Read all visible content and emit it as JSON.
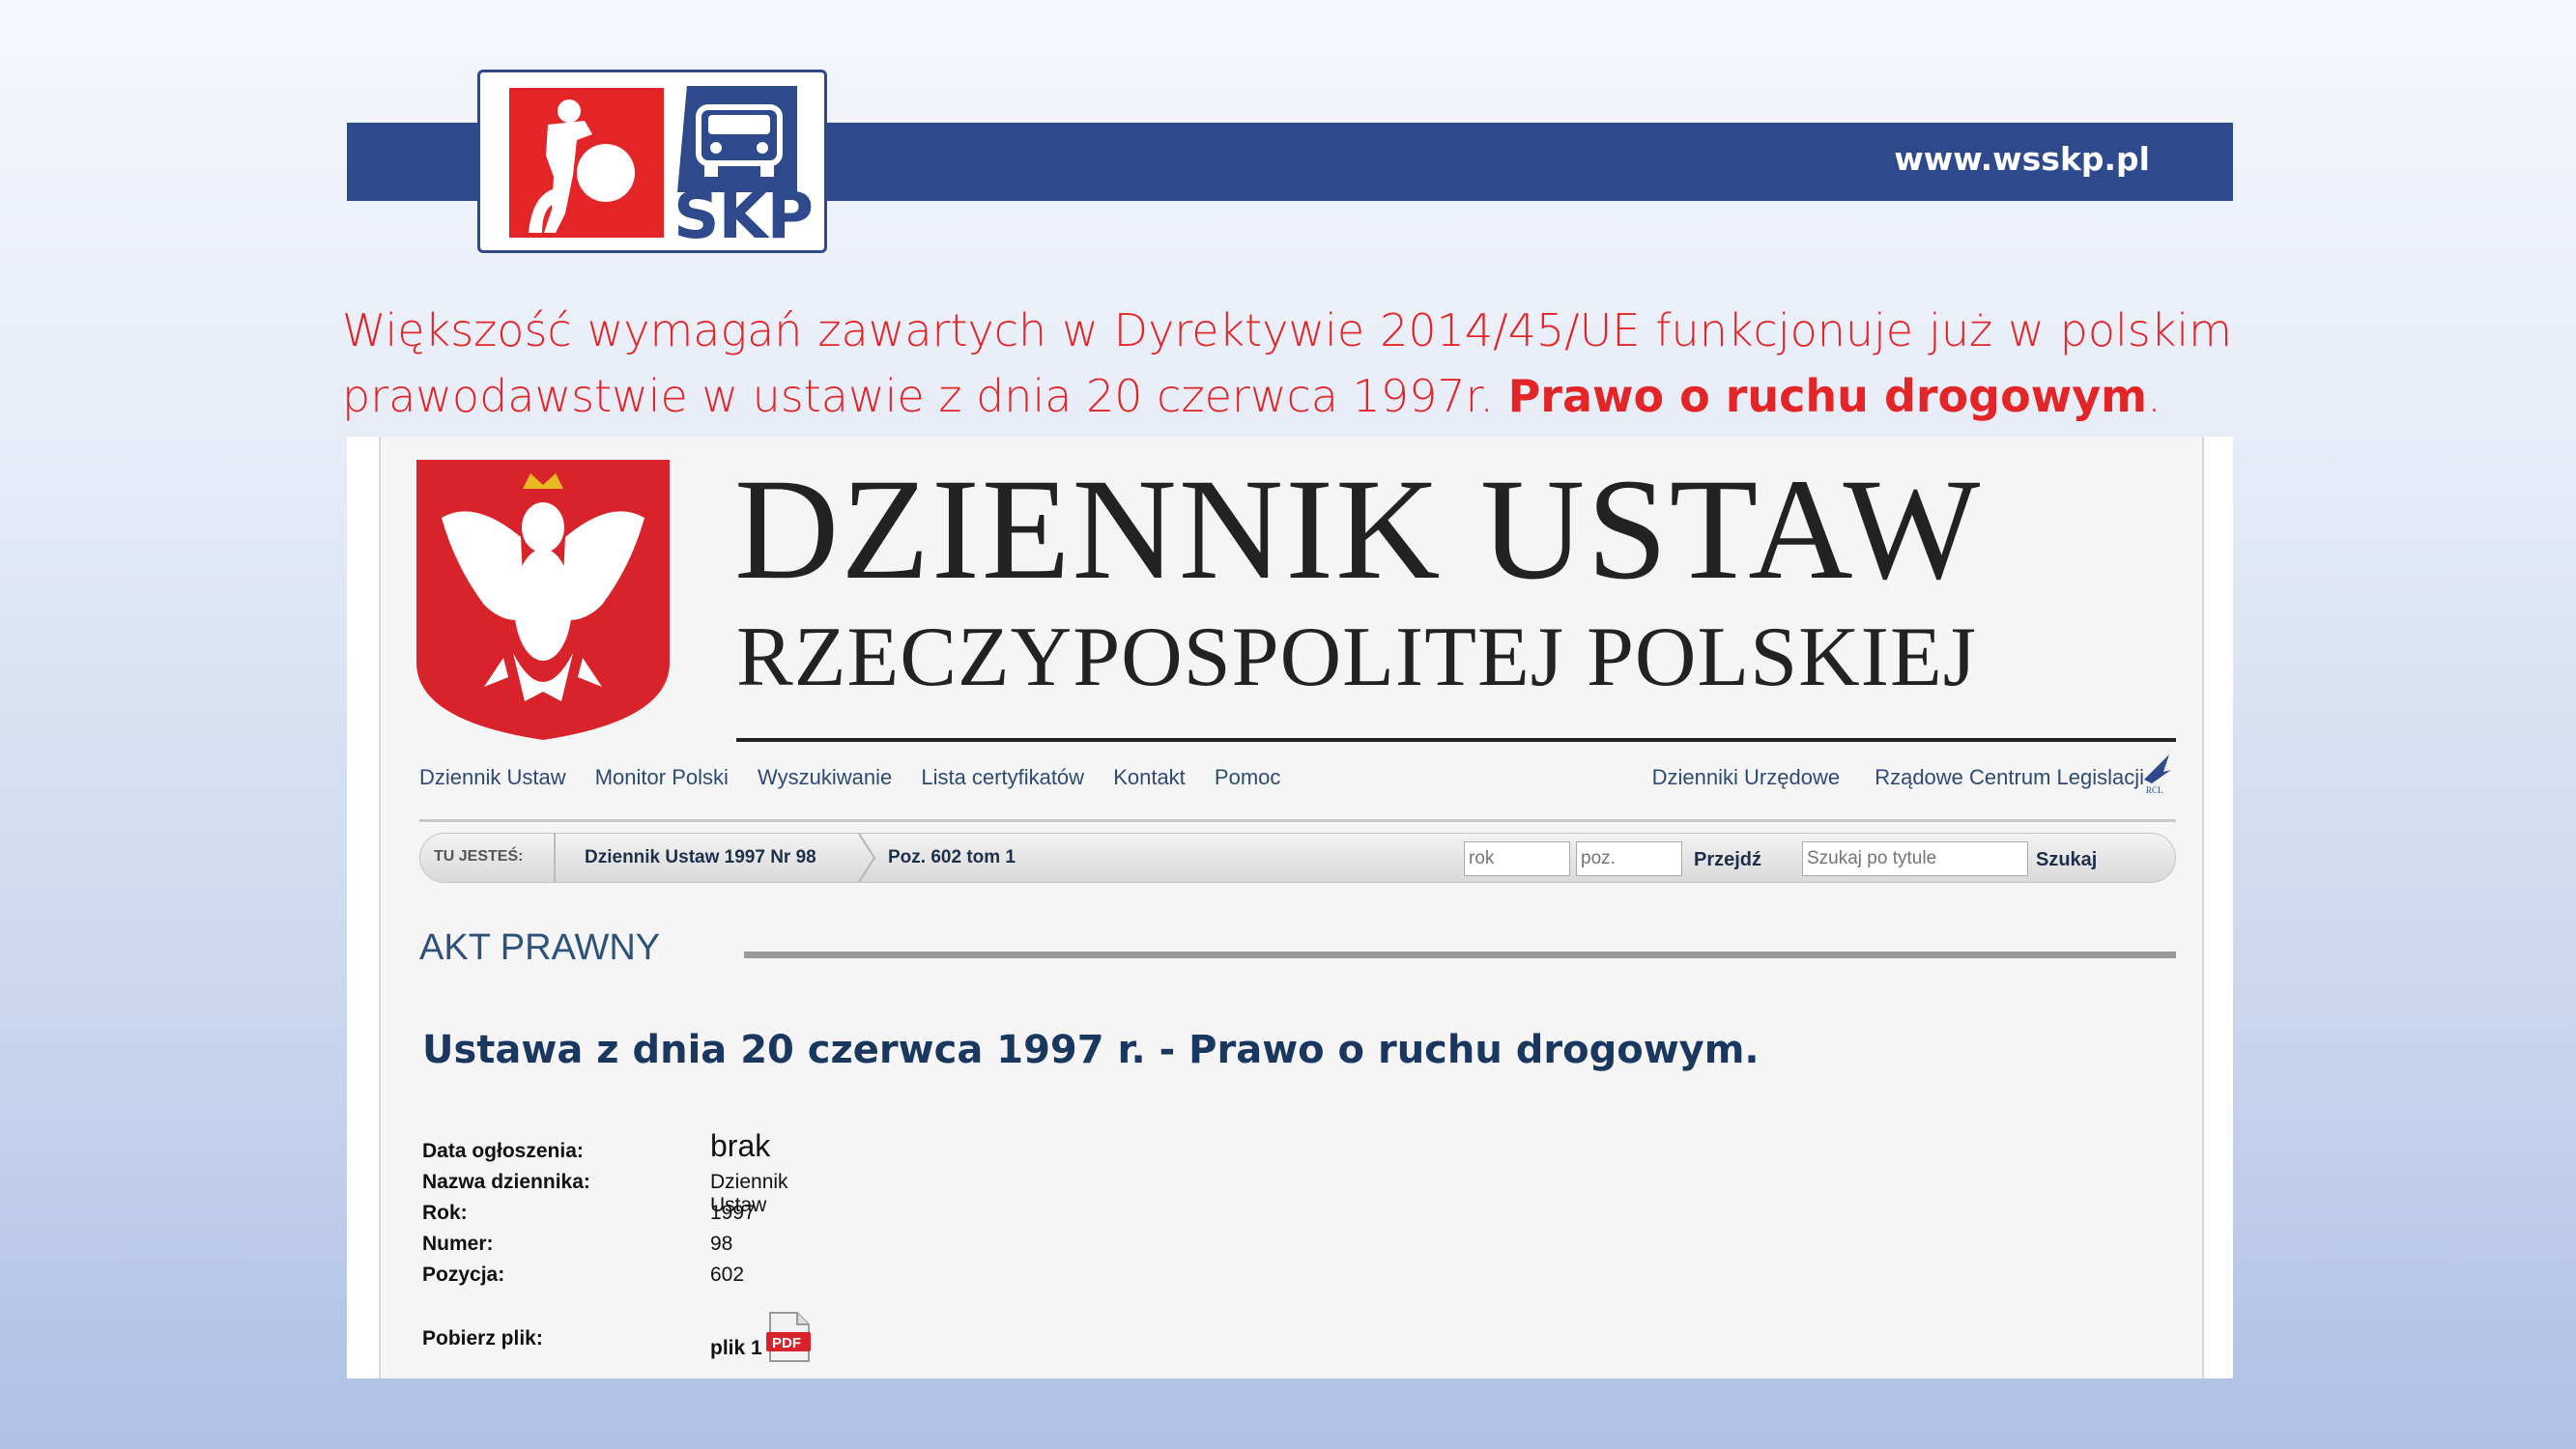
{
  "header": {
    "site_url": "www.wsskp.pl",
    "logo_text": "SKP"
  },
  "intro": {
    "text": "Większość wymagań zawartych w Dyrektywie 2014/45/UE funkcjonuje już w polskim prawodawstwie w ustawie z dnia 20 czerwca 1997r.",
    "highlight": "Prawo o ruchu drogowym",
    "end": "."
  },
  "screenshot": {
    "title": "DZIENNIK USTAW",
    "subtitle": "RZECZYPOSPOLITEJ POLSKIEJ",
    "nav_left": [
      "Dziennik Ustaw",
      "Monitor Polski",
      "Wyszukiwanie",
      "Lista certyfikatów",
      "Kontakt",
      "Pomoc"
    ],
    "nav_right": [
      "Dzienniki Urzędowe",
      "Rządowe Centrum Legislacji"
    ],
    "breadcrumb": {
      "label": "TU JESTEŚ:",
      "item1": "Dziennik Ustaw 1997 Nr 98",
      "item2": "Poz. 602 tom 1"
    },
    "search": {
      "rok_placeholder": "rok",
      "poz_placeholder": "poz.",
      "go_label": "Przejdź",
      "title_placeholder": "Szukaj po tytule",
      "search_label": "Szukaj"
    },
    "section_heading": "AKT PRAWNY",
    "law_title": "Ustawa z dnia 20 czerwca 1997 r. - Prawo o ruchu drogowym.",
    "meta": [
      {
        "key": "Data ogłoszenia:",
        "value": "brak"
      },
      {
        "key": "Nazwa dziennika:",
        "value": "Dziennik Ustaw"
      },
      {
        "key": "Rok:",
        "value": "1997"
      },
      {
        "key": "Numer:",
        "value": "98"
      },
      {
        "key": "Pozycja:",
        "value": "602"
      }
    ],
    "download": {
      "key": "Pobierz plik:",
      "value": "plik 1",
      "icon_label": "PDF"
    },
    "rcl_label": "RCL"
  },
  "colors": {
    "brand_blue": "#2e4a8c",
    "brand_red": "#e32528",
    "link_blue": "#2e4a73"
  }
}
